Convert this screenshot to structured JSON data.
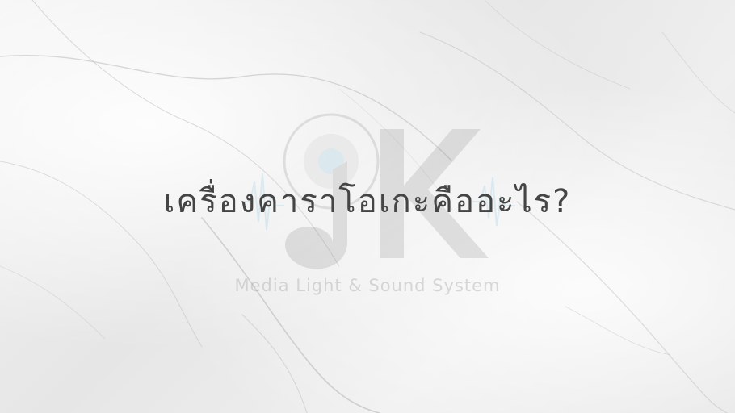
{
  "headline": "เครื่องคาราโอเกะคืออะไร?",
  "watermark": {
    "mark": "K",
    "caption": "Media Light & Sound System",
    "accent_color": "#7fc4e0"
  },
  "colors": {
    "background": "#ededed",
    "headline_text": "#454545"
  }
}
